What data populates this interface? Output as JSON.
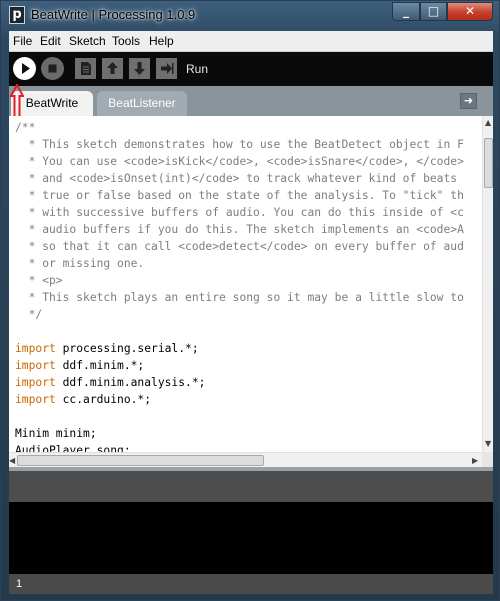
{
  "window": {
    "title": "BeatWrite | Processing 1.0.9",
    "app_icon_letter": "p",
    "controls": {
      "minimize": "_",
      "maximize": "□",
      "close": "✕"
    }
  },
  "menu": {
    "items": [
      "File",
      "Edit",
      "Sketch",
      "Tools",
      "Help"
    ]
  },
  "toolbar": {
    "buttons": [
      "run-icon",
      "stop-icon",
      "new-icon",
      "open-icon",
      "save-icon",
      "export-icon"
    ],
    "status_label": "Run"
  },
  "tabs": {
    "items": [
      {
        "label": "BeatWrite",
        "active": true
      },
      {
        "label": "BeatListener",
        "active": false
      }
    ],
    "menu_icon": "right-arrow-icon"
  },
  "editor": {
    "lines": [
      {
        "t": "c",
        "text": "/**"
      },
      {
        "t": "c",
        "text": "  * This sketch demonstrates how to use the BeatDetect object in F"
      },
      {
        "t": "c",
        "text": "  * You can use <code>isKick</code>, <code>isSnare</code>, </code>"
      },
      {
        "t": "c",
        "text": "  * and <code>isOnset(int)</code> to track whatever kind of beats"
      },
      {
        "t": "c",
        "text": "  * true or false based on the state of the analysis. To \"tick\" th"
      },
      {
        "t": "c",
        "text": "  * with successive buffers of audio. You can do this inside of <c"
      },
      {
        "t": "c",
        "text": "  * audio buffers if you do this. The sketch implements an <code>A"
      },
      {
        "t": "c",
        "text": "  * so that it can call <code>detect</code> on every buffer of aud"
      },
      {
        "t": "c",
        "text": "  * or missing one."
      },
      {
        "t": "c",
        "text": "  * <p>"
      },
      {
        "t": "c",
        "text": "  * This sketch plays an entire song so it may be a little slow to"
      },
      {
        "t": "c",
        "text": "  */"
      },
      {
        "t": "p",
        "text": ""
      },
      {
        "t": "i",
        "kw": "import",
        "text": " processing.serial.*;"
      },
      {
        "t": "i",
        "kw": "import",
        "text": " ddf.minim.*;"
      },
      {
        "t": "i",
        "kw": "import",
        "text": " ddf.minim.analysis.*;"
      },
      {
        "t": "i",
        "kw": "import",
        "text": " cc.arduino.*;"
      },
      {
        "t": "p",
        "text": ""
      },
      {
        "t": "p",
        "text": "Minim minim;"
      },
      {
        "t": "p",
        "text": "AudioPlayer song;"
      }
    ]
  },
  "status": {
    "line_number": "1"
  },
  "colors": {
    "comment": "#7e7e7e",
    "keyword": "#cc6600",
    "annotation_arrow": "#e02020"
  }
}
